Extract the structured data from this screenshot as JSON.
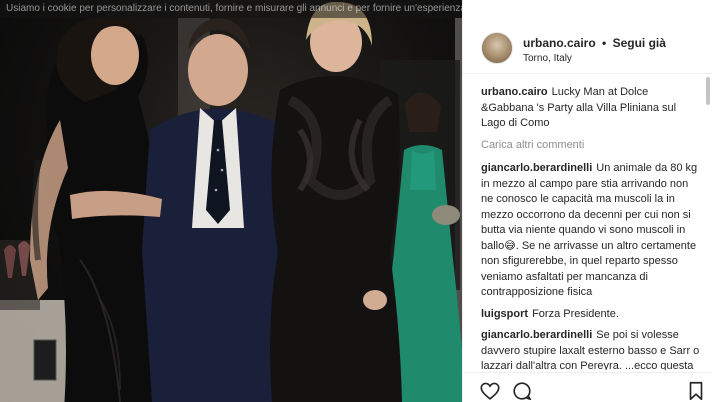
{
  "photo": {
    "cookie_notice": "Usiamo i cookie per personalizzare i contenuti, fornire e misurare gli annunci e per fornire un'esperienza più sicura. Cliccando o navigando sul sito, accetti che raccogliamo"
  },
  "post": {
    "username": "urbano.cairo",
    "separator": "•",
    "follow_label": "Segui già",
    "location": "Torno, Italy",
    "caption_user": "urbano.cairo",
    "caption_text": "Lucky Man at Dolce &Gabbana 's Party alla Villa Pliniana sul Lago di Como",
    "load_more": "Carica altri commenti"
  },
  "comments": [
    {
      "user": "giancarlo.berardinelli",
      "text": "Un animale da 80 kg in mezzo al campo pare stia arrivando non ne conosco le capacità ma muscoli la in mezzo occorrono da decenni per cui non si butta via niente quando vi sono muscoli in ballo😅. Se ne arrivasse un altro certamente non sfigurerebbe, in quel reparto spesso veniamo asfaltati per mancanza di contrapposizione fisica"
    },
    {
      "user": "luigsport",
      "text": "Forza Presidente."
    },
    {
      "user": "giancarlo.berardinelli",
      "text": "Se poi si volesse davvero stupire laxalt esterno basso e Sarr o lazzari dall'altra con Pereyra. ...ecco questa sarebbe una campagna acquisti sontuosa .Al netto delle cessioni di Niang e"
    }
  ],
  "icons": {
    "like": "heart-icon",
    "comment": "comment-icon",
    "save": "bookmark-icon"
  }
}
